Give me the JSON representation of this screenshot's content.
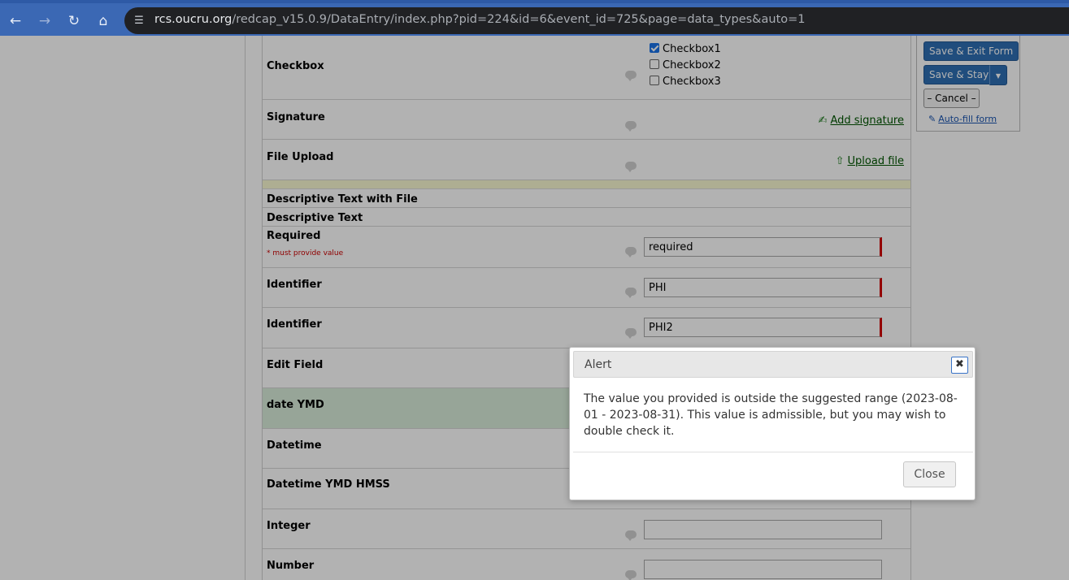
{
  "browser": {
    "url_host": "rcs.oucru.org",
    "url_path": "/redcap_v15.0.9/DataEntry/index.php?pid=224&id=6&event_id=725&page=data_types&auto=1",
    "icons": [
      "back-icon",
      "forward-icon",
      "reload-icon",
      "home-icon",
      "site-info-icon"
    ]
  },
  "form": {
    "checkbox": {
      "label": "Checkbox",
      "options": [
        "Checkbox1",
        "Checkbox2",
        "Checkbox3"
      ],
      "checked": [
        "Checkbox1"
      ]
    },
    "signature": {
      "label": "Signature",
      "link": "Add signature"
    },
    "file_upload": {
      "label": "File Upload",
      "link": "Upload file"
    },
    "desc_file": {
      "label": "Descriptive Text with File"
    },
    "desc_text": {
      "label": "Descriptive Text"
    },
    "required": {
      "label": "Required",
      "note": "* must provide value",
      "value": "required"
    },
    "identifier1": {
      "label": "Identifier",
      "value": "PHI"
    },
    "identifier2": {
      "label": "Identifier",
      "value": "PHI2"
    },
    "edit_field": {
      "label": "Edit Field"
    },
    "date_ymd": {
      "label": "date YMD"
    },
    "datetime": {
      "label": "Datetime"
    },
    "datetime_ymd_hmss": {
      "label": "Datetime YMD HMSS"
    },
    "integer": {
      "label": "Integer",
      "value": ""
    },
    "number": {
      "label": "Number",
      "value": ""
    }
  },
  "save_panel": {
    "save_exit": "Save & Exit Form",
    "save_stay": "Save & Stay",
    "cancel": "– Cancel –",
    "autofill": "Auto-fill form"
  },
  "dialog": {
    "title": "Alert",
    "message": "The value you provided is outside the suggested range (2023-08-01 - 2023-08-31). This value is admissible, but you may wish to double check it.",
    "close_button": "Close"
  },
  "colors": {
    "browser_bar": "#3b68b4",
    "required_marker": "#d40000",
    "highlight_row": "#d9ecda",
    "primary_button": "#2f6fb3",
    "link_green": "#005500"
  }
}
